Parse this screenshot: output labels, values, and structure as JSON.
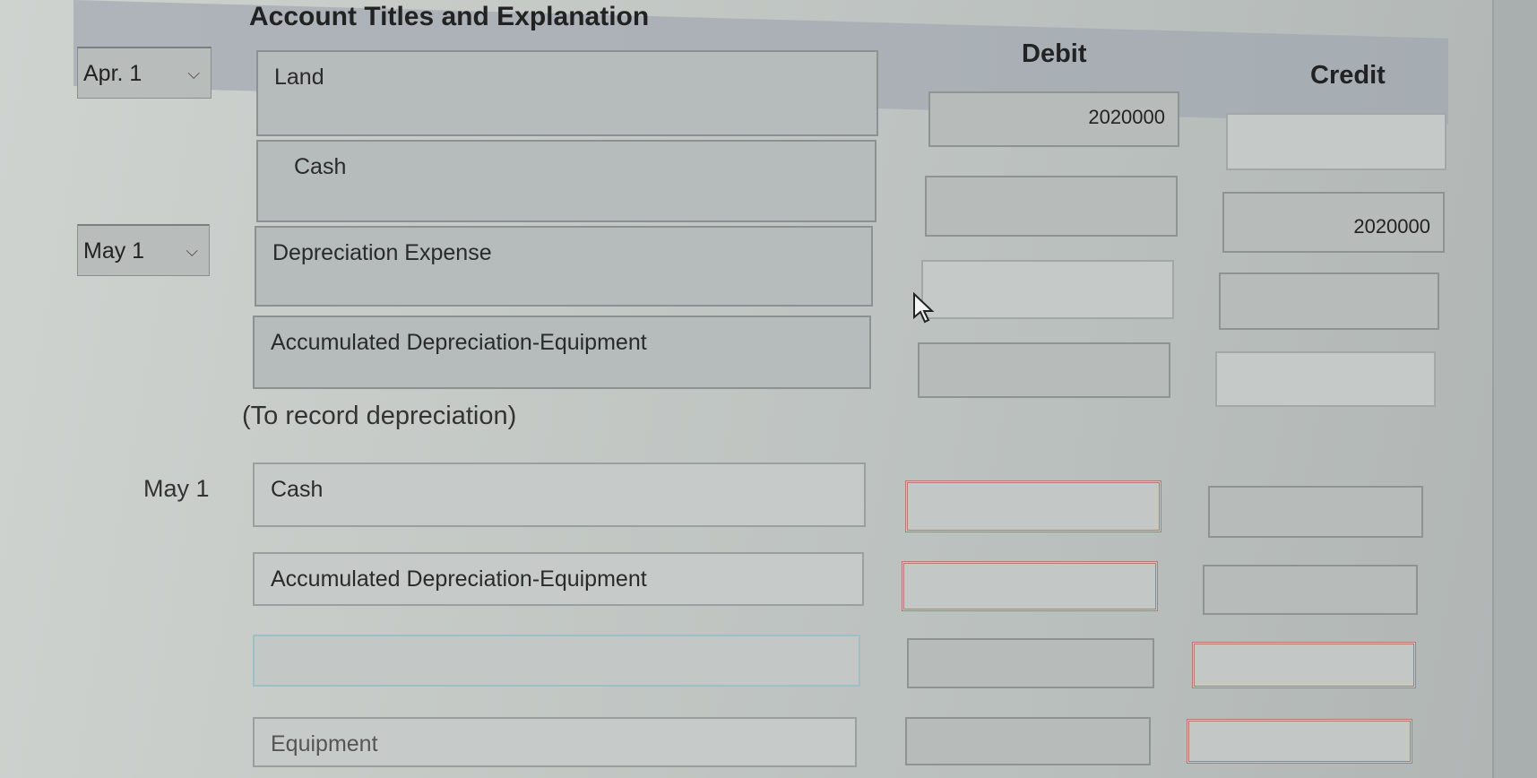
{
  "header": {
    "account_titles": "Account Titles and Explanation",
    "debit": "Debit",
    "credit": "Credit"
  },
  "entries": [
    {
      "date": "Apr. 1",
      "account": "Land",
      "debit": "2020000",
      "credit": ""
    },
    {
      "date": "",
      "account": "Cash",
      "debit": "",
      "credit": "2020000"
    },
    {
      "date": "May 1",
      "account": "Depreciation Expense",
      "debit": "",
      "credit": ""
    },
    {
      "date": "",
      "account": "Accumulated Depreciation-Equipment",
      "debit": "",
      "credit": ""
    }
  ],
  "note": "(To record depreciation)",
  "entries2": [
    {
      "date": "May 1",
      "account": "Cash",
      "debit": "",
      "credit": ""
    },
    {
      "date": "",
      "account": "Accumulated Depreciation-Equipment",
      "debit": "",
      "credit": ""
    },
    {
      "date": "",
      "account": "",
      "debit": "",
      "credit": ""
    },
    {
      "date": "",
      "account": "Equipment",
      "debit": "",
      "credit": ""
    }
  ],
  "icons": {
    "dropdown": "chevron-down-icon",
    "cursor": "mouse-pointer-icon"
  }
}
